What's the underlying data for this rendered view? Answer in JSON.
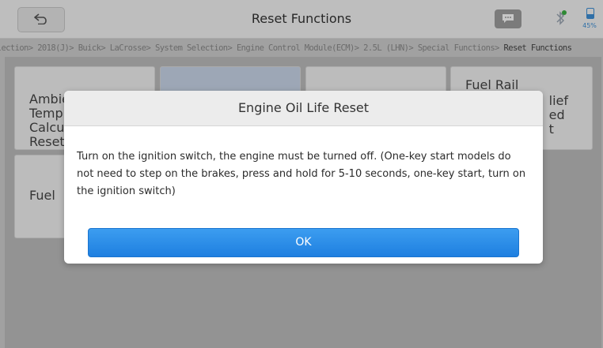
{
  "header": {
    "title": "Reset Functions",
    "battery_text": "45%",
    "battery_level": 0.45,
    "icons": [
      "back-icon",
      "chat-icon",
      "bluetooth-icon",
      "battery-icon"
    ],
    "colors": {
      "accent": "#1e7fe0",
      "battery": "#3d8fd6",
      "bluetooth_dot": "#3cb043"
    }
  },
  "breadcrumb": {
    "trail": "election> 2018(J)> Buick> LaCrosse> System Selection> Engine Control Module(ECM)> 2.5L (LHN)> Special Functions> ",
    "current": "Reset Functions"
  },
  "tiles": [
    {
      "label": "Ambient Air\nTemp\nCalcu\nReset"
    },
    {
      "label": ""
    },
    {
      "label": ""
    },
    {
      "label": "Fuel Rail",
      "peek": "lief\ned\nt"
    },
    {
      "label": "Fuel"
    }
  ],
  "dialog": {
    "title": "Engine Oil Life Reset",
    "message": "Turn on the ignition switch, the engine must be turned off. (One-key start models do not need to step on the brakes, press and hold for 5-10 seconds, one-key start, turn on the ignition switch)",
    "ok_label": "OK"
  }
}
